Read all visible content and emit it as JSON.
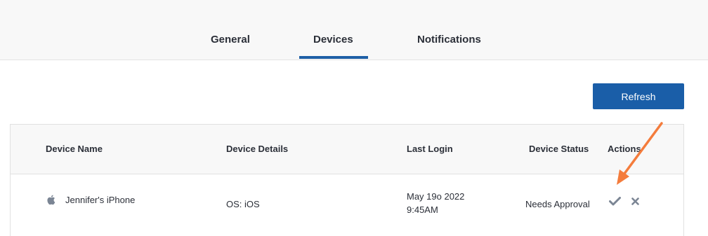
{
  "tabs": {
    "general": "General",
    "devices": "Devices",
    "notifications": "Notifications"
  },
  "toolbar": {
    "refresh_label": "Refresh"
  },
  "table": {
    "headers": {
      "device_name": "Device Name",
      "device_details": "Device Details",
      "last_login": "Last Login",
      "device_status": "Device Status",
      "actions": "Actions"
    },
    "rows": [
      {
        "icon": "apple-icon",
        "device_name": "Jennifer's iPhone",
        "device_details": "OS: iOS",
        "last_login_date": "May 19o 2022",
        "last_login_time": "9:45AM",
        "device_status": "Needs Approval",
        "actions": [
          "approve-check-icon",
          "reject-x-icon"
        ]
      }
    ]
  },
  "colors": {
    "accent": "#1a5ea8",
    "annotation_arrow": "#f47c3c",
    "icon_gray": "#7b8594"
  }
}
